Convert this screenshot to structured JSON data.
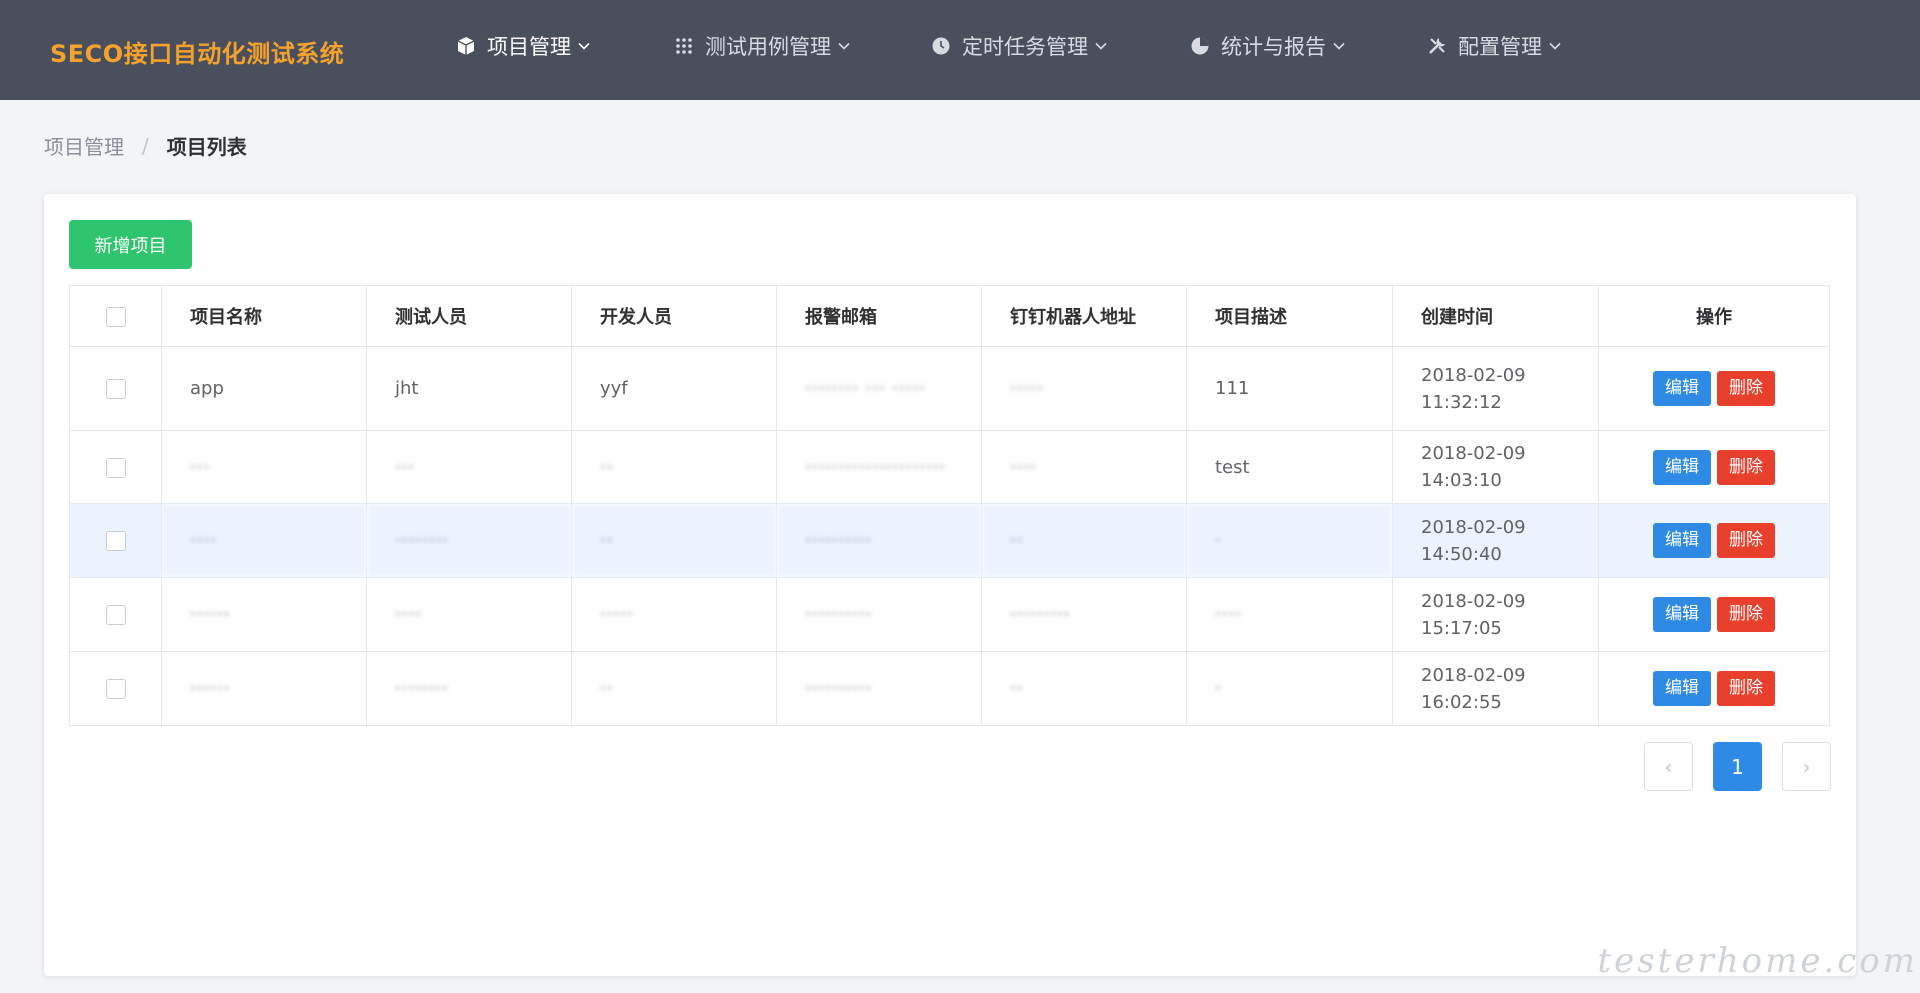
{
  "app": {
    "brand": "SECO接口自动化测试系统",
    "nav": [
      {
        "label": "项目管理",
        "icon": "cube-icon"
      },
      {
        "label": "测试用例管理",
        "icon": "grid-icon"
      },
      {
        "label": "定时任务管理",
        "icon": "clock-icon"
      },
      {
        "label": "统计与报告",
        "icon": "pie-chart-icon"
      },
      {
        "label": "配置管理",
        "icon": "tools-icon"
      }
    ],
    "active_nav": "项目管理"
  },
  "breadcrumb": {
    "parent": "项目管理",
    "separator": "/",
    "current": "项目列表"
  },
  "toolbar": {
    "add_label": "新增项目"
  },
  "table": {
    "headers": [
      "项目名称",
      "测试人员",
      "开发人员",
      "报警邮箱",
      "钉钉机器人地址",
      "项目描述",
      "创建时间",
      "操作"
    ],
    "rows": [
      {
        "name": "app",
        "tester": "jht",
        "developer": "yyf",
        "email": "········ ··· ·····",
        "dingtalk": "·····",
        "desc": "111",
        "created": "2018-02-09 11:32:12"
      },
      {
        "name": "···",
        "tester": "···",
        "developer": "··",
        "email": "·····················",
        "dingtalk": "····",
        "desc": "test",
        "created": "2018-02-09 14:03:10"
      },
      {
        "name": "····",
        "tester": "········",
        "developer": "··",
        "email": "··········",
        "dingtalk": "··",
        "desc": "·",
        "created": "2018-02-09 14:50:40"
      },
      {
        "name": "······",
        "tester": "····",
        "developer": "·····",
        "email": "··········",
        "dingtalk": "·········",
        "desc": "····",
        "created": "2018-02-09 15:17:05"
      },
      {
        "name": "······",
        "tester": "········",
        "developer": "··",
        "email": "··········",
        "dingtalk": "··",
        "desc": "·",
        "created": "2018-02-09 16:02:55"
      }
    ],
    "edit_label": "编辑",
    "delete_label": "删除",
    "highlighted_row": 2
  },
  "pagination": {
    "current_page": "1",
    "prev_symbol": "‹",
    "next_symbol": "›"
  },
  "watermark": "testerhome.com",
  "colors": {
    "nav_bg": "#4a4f5e",
    "brand": "#f5a22c",
    "primary": "#2f8ae5",
    "success": "#2fc46e",
    "danger": "#e9402d",
    "row_highlight": "#ebf4fd"
  }
}
